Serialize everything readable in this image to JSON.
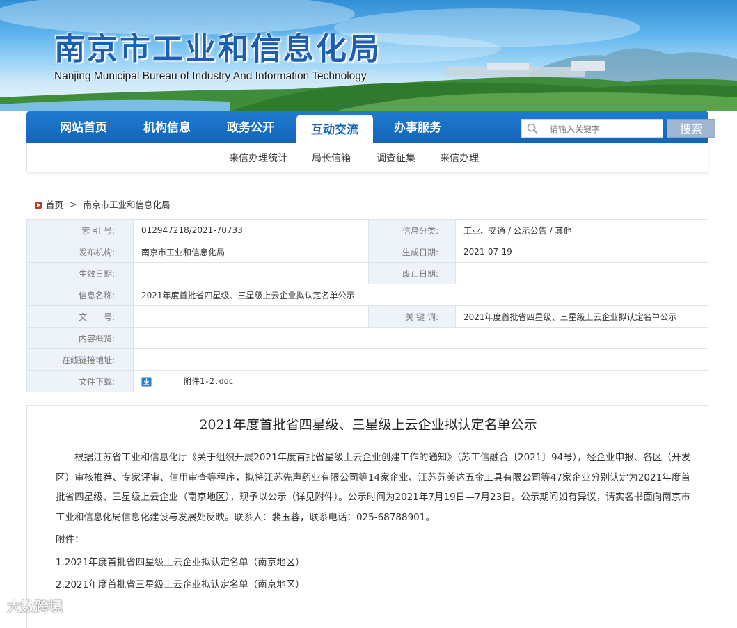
{
  "header": {
    "title": "南京市工业和信息化局",
    "subtitle": "Nanjing Municipal Bureau of Industry And Information Technology"
  },
  "nav": {
    "items": [
      {
        "label": "网站首页"
      },
      {
        "label": "机构信息"
      },
      {
        "label": "政务公开"
      },
      {
        "label": "互动交流"
      },
      {
        "label": "办事服务"
      }
    ],
    "active": "互动交流",
    "search_placeholder": "请输入关键字",
    "search_button": "搜索"
  },
  "subnav": {
    "items": [
      {
        "label": "来信办理统计"
      },
      {
        "label": "局长信箱"
      },
      {
        "label": "调查征集"
      },
      {
        "label": "来信办理"
      }
    ]
  },
  "breadcrumb": {
    "home": "首页",
    "current": "南京市工业和信息化局"
  },
  "meta": {
    "index_no_label": "索 引 号:",
    "index_no": "012947218/2021-70733",
    "category_label": "信息分类:",
    "category": "工业、交通 / 公示公告 / 其他",
    "publisher_label": "发布机构:",
    "publisher": "南京市工业和信息化局",
    "date_label": "生成日期:",
    "date": "2021-07-19",
    "effective_label": "生效日期:",
    "effective": "",
    "expire_label": "废止日期:",
    "expire": "",
    "name_label": "信息名称:",
    "name": "2021年度首批省四星级、三星级上云企业拟认定名单公示",
    "doc_no_label": "文　　号:",
    "doc_no": "",
    "keywords_label": "关 键 词:",
    "keywords": "2021年度首批省四星级、三星级上云企业拟认定名单公示",
    "overview_label": "内容概览:",
    "overview": "",
    "link_label": "在线链接地址:",
    "link": "",
    "download_label": "文件下载:",
    "download_file": "附件1-2.doc"
  },
  "article": {
    "title": "2021年度首批省四星级、三星级上云企业拟认定名单公示",
    "paragraph": "根据江苏省工业和信息化厅《关于组织开展2021年度首批省星级上云企业创建工作的通知》（苏工信融合〔2021〕94号），经企业申报、各区（开发区）审核推荐、专家评审、信用审查等程序，拟将江苏先声药业有限公司等14家企业、江苏苏美达五金工具有限公司等47家企业分别认定为2021年度首批省四星级、三星级上云企业（南京地区），现予以公示（详见附件）。公示时间为2021年7月19日—7月23日。公示期间如有异议，请实名书面向南京市工业和信息化局信息化建设与发展处反映。联系人：裴玉蓉，联系电话：025-68788901。",
    "attachments_label": "附件：",
    "attachments": [
      "1.2021年度首批省四星级上云企业拟认定名单（南京地区）",
      "2.2021年度首批省三星级上云企业拟认定名单（南京地区）"
    ]
  },
  "watermark": "大数跨境"
}
